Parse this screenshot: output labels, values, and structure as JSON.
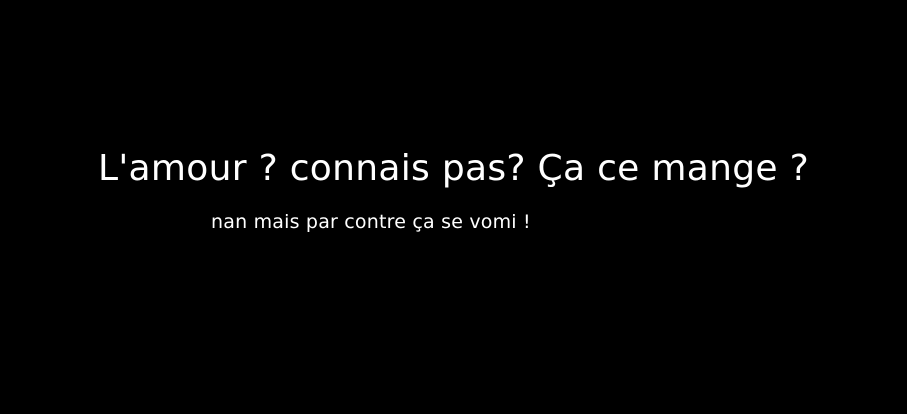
{
  "colors": {
    "background": "#000000",
    "text": "#ffffff"
  },
  "text": {
    "headline": "L'amour ? connais pas? Ça ce mange ?",
    "subline": "nan mais par contre ça se vomi !"
  }
}
